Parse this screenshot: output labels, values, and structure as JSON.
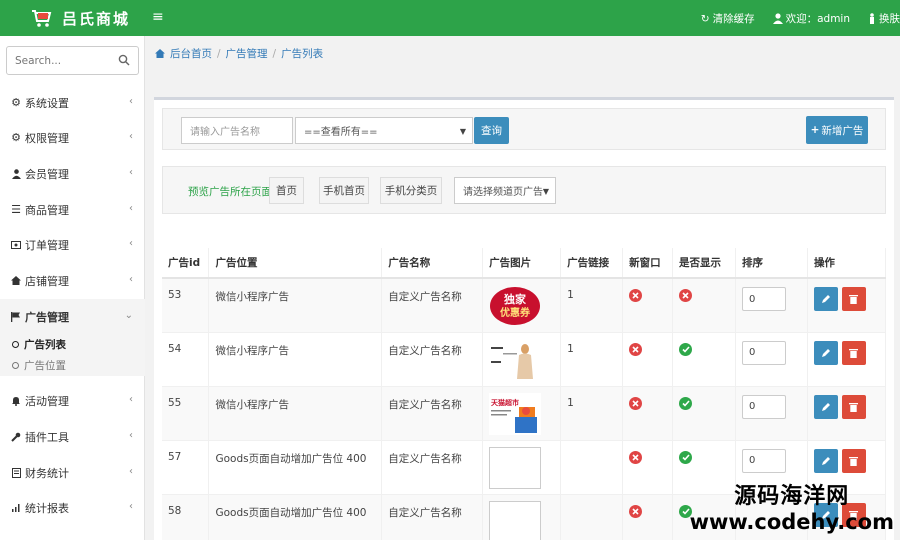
{
  "header": {
    "brand": "吕氏商城",
    "clear_cache": "清除缓存",
    "welcome": "欢迎：admin",
    "theme": "换肤"
  },
  "sidebar": {
    "search_placeholder": "Search...",
    "items": [
      {
        "label": "系统设置",
        "icon": "gear-icon"
      },
      {
        "label": "权限管理",
        "icon": "gears-icon"
      },
      {
        "label": "会员管理",
        "icon": "user-icon"
      },
      {
        "label": "商品管理",
        "icon": "list-icon"
      },
      {
        "label": "订单管理",
        "icon": "card-icon"
      },
      {
        "label": "店铺管理",
        "icon": "home-icon"
      },
      {
        "label": "广告管理",
        "icon": "flag-icon"
      },
      {
        "label": "活动管理",
        "icon": "bell-icon"
      },
      {
        "label": "插件工具",
        "icon": "wrench-icon"
      },
      {
        "label": "财务统计",
        "icon": "book-icon"
      },
      {
        "label": "统计报表",
        "icon": "bar-chart-icon"
      }
    ],
    "sub_items": [
      "广告列表",
      "广告位置"
    ]
  },
  "breadcrumb": [
    "后台首页",
    "广告管理",
    "广告列表"
  ],
  "filters": {
    "name_placeholder": "请输入广告名称",
    "select_value": "==查看所有==",
    "search_button": "查询",
    "add_button": "新增广告",
    "preview_label": "预览广告所在页面:",
    "preview_buttons": [
      "首页",
      "手机首页",
      "手机分类页"
    ],
    "channel_select": "请选择频道页广告"
  },
  "table": {
    "headers": [
      "广告id",
      "广告位置",
      "广告名称",
      "广告图片",
      "广告链接",
      "新窗口",
      "是否显示",
      "排序",
      "操作"
    ],
    "rows": [
      {
        "id": "53",
        "position": "微信小程序广告",
        "name": "自定义广告名称",
        "image": "独家优惠券",
        "link": "1",
        "new_window": false,
        "show": false,
        "sort": "0"
      },
      {
        "id": "54",
        "position": "微信小程序广告",
        "name": "自定义广告名称",
        "image": "product-thumb",
        "link": "1",
        "new_window": false,
        "show": true,
        "sort": "0"
      },
      {
        "id": "55",
        "position": "微信小程序广告",
        "name": "自定义广告名称",
        "image": "天猫超市",
        "link": "1",
        "new_window": false,
        "show": true,
        "sort": "0"
      },
      {
        "id": "57",
        "position": "Goods页面自动增加广告位 400",
        "name": "自定义广告名称",
        "image": "",
        "link": "",
        "new_window": false,
        "show": true,
        "sort": "0"
      },
      {
        "id": "58",
        "position": "Goods页面自动增加广告位 400",
        "name": "自定义广告名称",
        "image": "",
        "link": "",
        "new_window": false,
        "show": true,
        "sort": ""
      }
    ]
  },
  "watermark": {
    "line1": "源码海洋网",
    "line2": "www.codehy.com"
  },
  "colors": {
    "brand_green": "#2da349",
    "primary_blue": "#3c8dbc",
    "danger_red": "#dd4b39"
  }
}
